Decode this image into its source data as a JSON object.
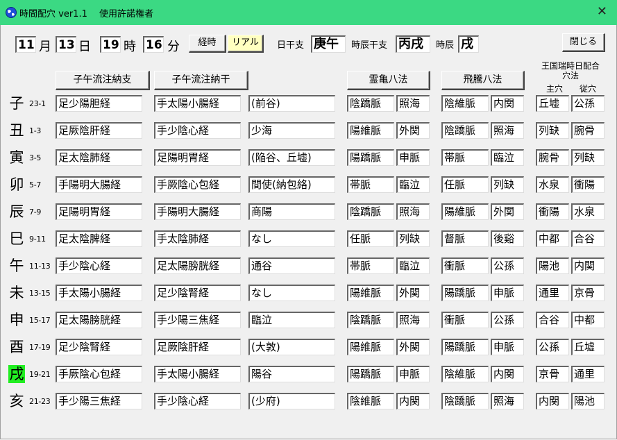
{
  "window": {
    "title": "時間配穴 ver1.1　 使用許諾権者",
    "close_glyph": "✕"
  },
  "datetime": {
    "month": "11",
    "month_label": "月",
    "day": "13",
    "day_label": "日",
    "hour": "19",
    "hour_label": "時",
    "minute": "16",
    "minute_label": "分"
  },
  "buttons": {
    "keiji": "経時",
    "real": "リアル",
    "close": "閉じる",
    "shigo_shi": "子午流注納支",
    "shigo_kan": "子午流注納干",
    "reiki": "霊亀八法",
    "hitou": "飛騰八法"
  },
  "ganzhi": {
    "day_label": "日干支",
    "day_value": "庚午",
    "hour_label": "時辰干支",
    "hour_value": "丙戌",
    "shichen_label": "時辰",
    "shichen_value": "戌"
  },
  "ouko": {
    "title_line1": "王国瑞時日配合",
    "title_line2": "穴法",
    "main": "主穴",
    "sub": "従穴"
  },
  "rows": [
    {
      "branch": "子",
      "time": "23-1",
      "shi": "足少陽胆経",
      "kan": "手太陽小腸経",
      "point": "(前谷)",
      "r1": "陰蹻脈",
      "r2": "照海",
      "h1": "陰維脈",
      "h2": "内関",
      "o1": "丘墟",
      "o2": "公孫",
      "active": false
    },
    {
      "branch": "丑",
      "time": "1-3",
      "shi": "足厥陰肝経",
      "kan": "手少陰心経",
      "point": "少海",
      "r1": "陽維脈",
      "r2": "外関",
      "h1": "陰蹻脈",
      "h2": "照海",
      "o1": "列缺",
      "o2": "腕骨",
      "active": false
    },
    {
      "branch": "寅",
      "time": "3-5",
      "shi": "足太陰肺経",
      "kan": "足陽明胃経",
      "point": "(陥谷、丘墟)",
      "r1": "陽蹻脈",
      "r2": "申脈",
      "h1": "帯脈",
      "h2": "臨泣",
      "o1": "腕骨",
      "o2": "列缺",
      "active": false
    },
    {
      "branch": "卯",
      "time": "5-7",
      "shi": "手陽明大腸経",
      "kan": "手厥陰心包経",
      "point": "間使(納包絡)",
      "r1": "帯脈",
      "r2": "臨泣",
      "h1": "任脈",
      "h2": "列缺",
      "o1": "水泉",
      "o2": "衝陽",
      "active": false
    },
    {
      "branch": "辰",
      "time": "7-9",
      "shi": "足陽明胃経",
      "kan": "手陽明大腸経",
      "point": "商陽",
      "r1": "陰蹻脈",
      "r2": "照海",
      "h1": "陽維脈",
      "h2": "外関",
      "o1": "衝陽",
      "o2": "水泉",
      "active": false
    },
    {
      "branch": "巳",
      "time": "9-11",
      "shi": "足太陰脾経",
      "kan": "手太陰肺経",
      "point": "なし",
      "r1": "任脈",
      "r2": "列缺",
      "h1": "督脈",
      "h2": "後谿",
      "o1": "中都",
      "o2": "合谷",
      "active": false
    },
    {
      "branch": "午",
      "time": "11-13",
      "shi": "手少陰心経",
      "kan": "足太陽膀胱経",
      "point": "通谷",
      "r1": "帯脈",
      "r2": "臨泣",
      "h1": "衝脈",
      "h2": "公孫",
      "o1": "陽池",
      "o2": "内関",
      "active": false
    },
    {
      "branch": "未",
      "time": "13-15",
      "shi": "手太陽小腸経",
      "kan": "足少陰腎経",
      "point": "なし",
      "r1": "陽維脈",
      "r2": "外関",
      "h1": "陽蹻脈",
      "h2": "申脈",
      "o1": "通里",
      "o2": "京骨",
      "active": false
    },
    {
      "branch": "申",
      "time": "15-17",
      "shi": "足太陽膀胱経",
      "kan": "手少陽三焦経",
      "point": "臨泣",
      "r1": "陰蹻脈",
      "r2": "照海",
      "h1": "衝脈",
      "h2": "公孫",
      "o1": "合谷",
      "o2": "中都",
      "active": false
    },
    {
      "branch": "酉",
      "time": "17-19",
      "shi": "足少陰腎経",
      "kan": "足厥陰肝経",
      "point": "(大敦)",
      "r1": "陽維脈",
      "r2": "外関",
      "h1": "陽蹻脈",
      "h2": "申脈",
      "o1": "公孫",
      "o2": "丘墟",
      "active": false
    },
    {
      "branch": "戌",
      "time": "19-21",
      "shi": "手厥陰心包経",
      "kan": "手太陽小腸経",
      "point": "陽谷",
      "r1": "陽蹻脈",
      "r2": "申脈",
      "h1": "陰維脈",
      "h2": "内関",
      "o1": "京骨",
      "o2": "通里",
      "active": true
    },
    {
      "branch": "亥",
      "time": "21-23",
      "shi": "手少陽三焦経",
      "kan": "手少陰心経",
      "point": "(少府)",
      "r1": "陰維脈",
      "r2": "内関",
      "h1": "陰蹻脈",
      "h2": "照海",
      "o1": "内関",
      "o2": "陽池",
      "active": false
    }
  ],
  "colors": {
    "titlebar": "#3bd983",
    "active_branch": "#22ee22",
    "real_button": "#ffffc0"
  },
  "icons": {
    "app": "globe-icon",
    "close": "close-icon"
  }
}
